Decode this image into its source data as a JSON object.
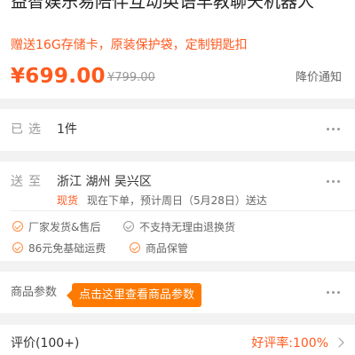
{
  "product": {
    "title": "益智娱乐易陪伴互动英语早教聊天机器人",
    "promo": "赠送16G存储卡，原装保护袋，定制钥匙扣",
    "price": "¥699.00",
    "old_price": "¥799.00",
    "notify_label": "降价通知"
  },
  "selected": {
    "label": "已选",
    "value": "1件"
  },
  "delivery": {
    "label": "送至",
    "address": "浙江 湖州 吴兴区",
    "stock_badge": "现货",
    "note": "现在下单，预计周日（5月28日）送达",
    "services": [
      "厂家发货&售后",
      "不支持无理由退换货",
      "86元免基础运费",
      "商品保管"
    ]
  },
  "params": {
    "label": "商品参数",
    "tooltip": "点击这里查看商品参数"
  },
  "reviews": {
    "label": "评价(100+)",
    "rate": "好评率:100%"
  },
  "colors": {
    "accent": "#ff5a1f",
    "tooltip_bg": "#ff7a00",
    "background": "#f2f2f2"
  }
}
